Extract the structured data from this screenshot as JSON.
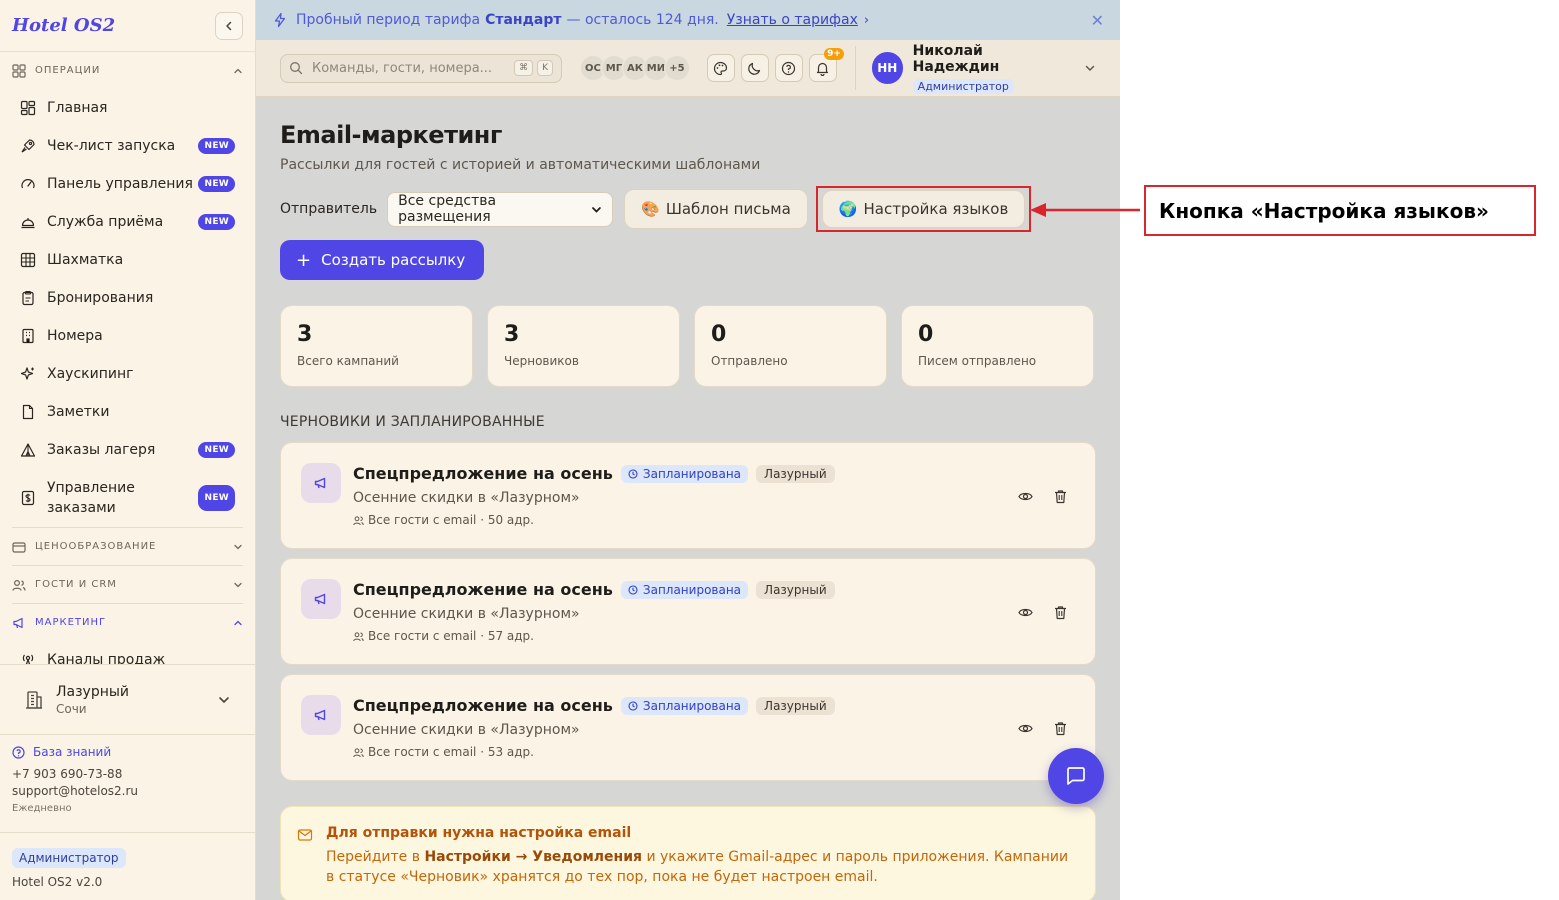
{
  "brand": "Hotel OS2",
  "sidebar": {
    "sections": [
      {
        "label": "Операции",
        "expanded": true
      },
      {
        "label": "Ценообразование",
        "expanded": false
      },
      {
        "label": "Гости и CRM",
        "expanded": false
      },
      {
        "label": "Маркетинг",
        "expanded": true
      }
    ],
    "operations": [
      {
        "label": "Главная",
        "icon": "dashboard-icon",
        "new": false
      },
      {
        "label": "Чек-лист запуска",
        "icon": "rocket-icon",
        "new": true
      },
      {
        "label": "Панель управления",
        "icon": "gauge-icon",
        "new": true
      },
      {
        "label": "Служба приёма",
        "icon": "bell-desk-icon",
        "new": true
      },
      {
        "label": "Шахматка",
        "icon": "grid-icon",
        "new": false
      },
      {
        "label": "Бронирования",
        "icon": "clipboard-icon",
        "new": false
      },
      {
        "label": "Номера",
        "icon": "building-icon",
        "new": false
      },
      {
        "label": "Хаускипинг",
        "icon": "sparkles-icon",
        "new": false
      },
      {
        "label": "Заметки",
        "icon": "note-icon",
        "new": false
      },
      {
        "label": "Заказы лагеря",
        "icon": "tent-icon",
        "new": true
      },
      {
        "label": "Управление заказами",
        "icon": "dollar-icon",
        "new": true
      }
    ],
    "new_badge": "NEW",
    "marketing": [
      {
        "label": "Каналы продаж",
        "icon": "antenna-icon"
      }
    ],
    "hotel": {
      "name": "Лазурный",
      "city": "Сочи"
    },
    "support": {
      "kb_label": "База знаний",
      "phone": "+7 903 690-73-88",
      "email": "support@hotelos2.ru",
      "hours": "Ежедневно"
    },
    "role": "Администратор",
    "version": "Hotel OS2 v2.0"
  },
  "trial": {
    "prefix": "Пробный период тарифа",
    "plan": "Стандарт",
    "suffix": "— осталось 124 дня.",
    "link": "Узнать о тарифах",
    "chevron": "›",
    "close": "✕"
  },
  "topbar": {
    "search_placeholder": "Команды, гости, номера...",
    "kbd_mod": "⌘",
    "kbd_key": "K",
    "presence": [
      "ОС",
      "МГ",
      "АК",
      "МИ",
      "+5"
    ],
    "notif_count": "9+",
    "user": {
      "initials": "НН",
      "name": "Николай Надеждин",
      "role": "Администратор"
    }
  },
  "page": {
    "title": "Email-маркетинг",
    "subtitle": "Рассылки для гостей с историей и автоматическими шаблонами",
    "sender_label": "Отправитель",
    "sender_value": "Все средства размещения",
    "template_btn": "Шаблон письма",
    "template_emoji": "🎨",
    "lang_btn": "Настройка языков",
    "lang_emoji": "🌍",
    "create_btn": "Создать рассылку",
    "create_plus": "+"
  },
  "stats": [
    {
      "value": "3",
      "label": "Всего кампаний"
    },
    {
      "value": "3",
      "label": "Черновиков"
    },
    {
      "value": "0",
      "label": "Отправлено"
    },
    {
      "value": "0",
      "label": "Писем отправлено"
    }
  ],
  "list_title": "Черновики и запланированные",
  "campaigns": [
    {
      "name": "Спецпредложение на осень",
      "status": "Запланирована",
      "hotel": "Лазурный",
      "desc": "Осенние скидки в «Лазурном»",
      "meta": "Все гости с email · 50 адр."
    },
    {
      "name": "Спецпредложение на осень",
      "status": "Запланирована",
      "hotel": "Лазурный",
      "desc": "Осенние скидки в «Лазурном»",
      "meta": "Все гости с email · 57 адр."
    },
    {
      "name": "Спецпредложение на осень",
      "status": "Запланирована",
      "hotel": "Лазурный",
      "desc": "Осенние скидки в «Лазурном»",
      "meta": "Все гости с email · 53 адр."
    }
  ],
  "notice": {
    "title": "Для отправки нужна настройка email",
    "text_a": "Перейдите в",
    "text_b": "Настройки → Уведомления",
    "text_c": "и укажите Gmail-адрес и пароль приложения. Кампании в статусе «Черновик» хранятся до тех пор, пока не будет настроен email."
  },
  "annotation": "Кнопка «Настройка языков»",
  "colors": {
    "accent": "#4f46e5",
    "annotation": "#d8262c",
    "warning": "#b45309"
  }
}
